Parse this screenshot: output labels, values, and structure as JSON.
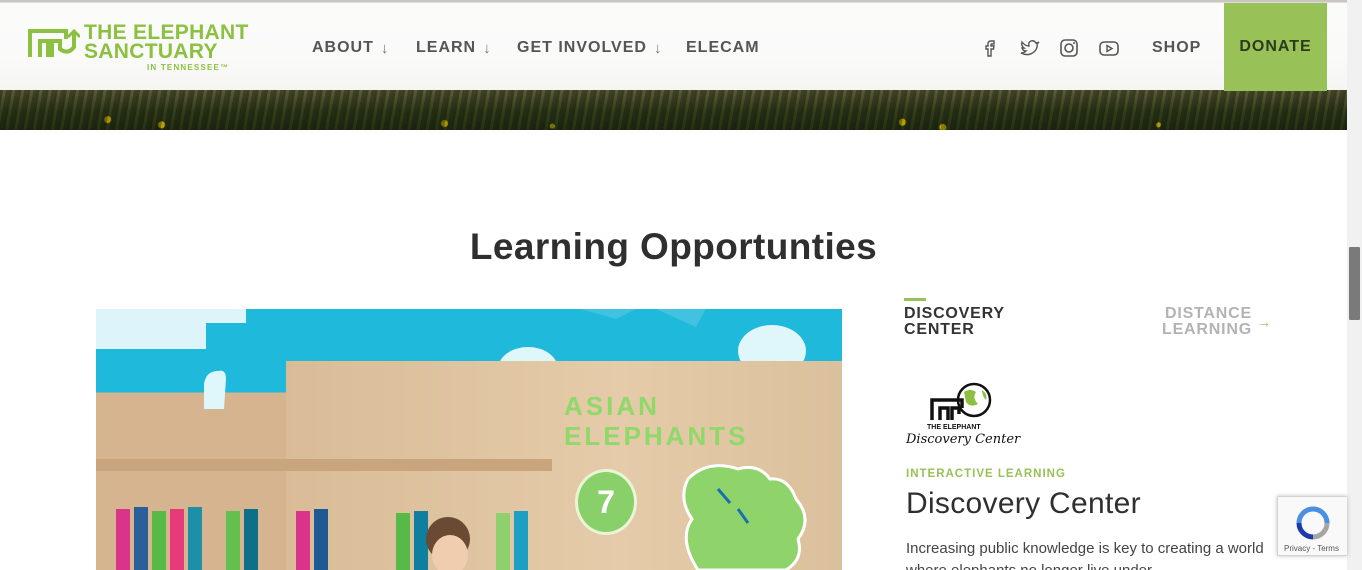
{
  "header": {
    "logo": {
      "line1": "THE ELEPHANT",
      "line2": "SANCTUARY",
      "line3": "IN TENNESSEE™"
    },
    "nav": [
      {
        "label": "ABOUT",
        "has_dropdown": true
      },
      {
        "label": "LEARN",
        "has_dropdown": true
      },
      {
        "label": "GET INVOLVED",
        "has_dropdown": true
      },
      {
        "label": "ELECAM",
        "has_dropdown": false
      }
    ],
    "dropdown_glyph": "↓",
    "social": [
      "facebook-icon",
      "twitter-icon",
      "instagram-icon",
      "youtube-icon"
    ],
    "shop_label": "SHOP",
    "donate_label": "DONATE",
    "accent": "#98c157"
  },
  "section": {
    "title": "Learning Opportunties"
  },
  "photo": {
    "sign_line1": "ASIAN",
    "sign_line2": "ELEPHANTS",
    "badge": "7"
  },
  "tabs": [
    {
      "label_line1": "DISCOVERY",
      "label_line2": "CENTER",
      "active": true
    },
    {
      "label_line1": "DISTANCE",
      "label_line2": "LEARNING",
      "active": false
    }
  ],
  "tab_arrow": "→",
  "card": {
    "logo_small": "THE ELEPHANT",
    "logo_script": "Discovery Center",
    "eyebrow": "INTERACTIVE LEARNING",
    "title": "Discovery Center",
    "body": "Increasing public knowledge is key to creating a world where elephants no longer live under"
  },
  "recaptcha": {
    "links": "Privacy - Terms"
  }
}
